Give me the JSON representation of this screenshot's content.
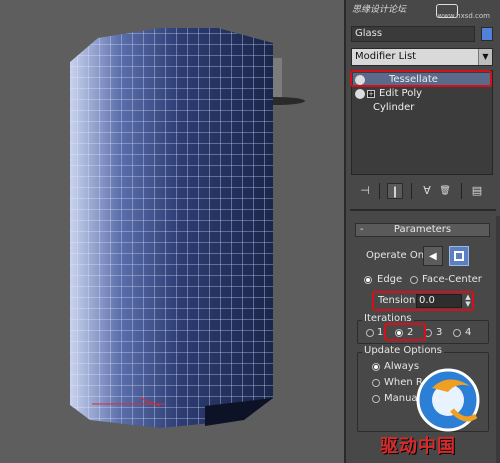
{
  "watermark": {
    "line1": "思缘设计论坛 ",
    "line2": "www.hxsd.com"
  },
  "object": {
    "name": "Glass",
    "color": "#4f82d8"
  },
  "modifier_list": {
    "label": "Modifier List",
    "arrow": "▼"
  },
  "stack": {
    "items": [
      {
        "label": "Tessellate",
        "selected": true,
        "icon": "lightbulb-icon"
      },
      {
        "label": "Edit Poly",
        "selected": false,
        "icon": "lightbulb-icon",
        "expander": "+"
      },
      {
        "label": "Cylinder",
        "selected": false
      }
    ]
  },
  "toolbar": {
    "buttons": [
      {
        "name": "pin-stack-icon",
        "glyph": "⊣"
      },
      {
        "name": "show-end-result-icon",
        "glyph": "❙"
      },
      {
        "name": "make-unique-icon",
        "glyph": "∀"
      },
      {
        "name": "remove-modifier-icon",
        "glyph": "🗑"
      },
      {
        "name": "configure-modifier-sets-icon",
        "glyph": "▤"
      }
    ]
  },
  "parameters": {
    "title": "Parameters",
    "collapse": "-",
    "operate_on_label": "Operate On:",
    "edge_label": "Edge",
    "face_center_label": "Face-Center",
    "tension_label": "Tension:",
    "tension_value": "0.0",
    "iterations_label": "Iterations",
    "iterations_options": [
      "1",
      "2",
      "3",
      "4"
    ],
    "iterations_selected": "2",
    "update_label": "Update Options",
    "update_options": [
      "Always",
      "When Rendering",
      "Manually"
    ]
  },
  "brand": {
    "cn": "驱动中国"
  },
  "highlight_color": "#d5101a"
}
